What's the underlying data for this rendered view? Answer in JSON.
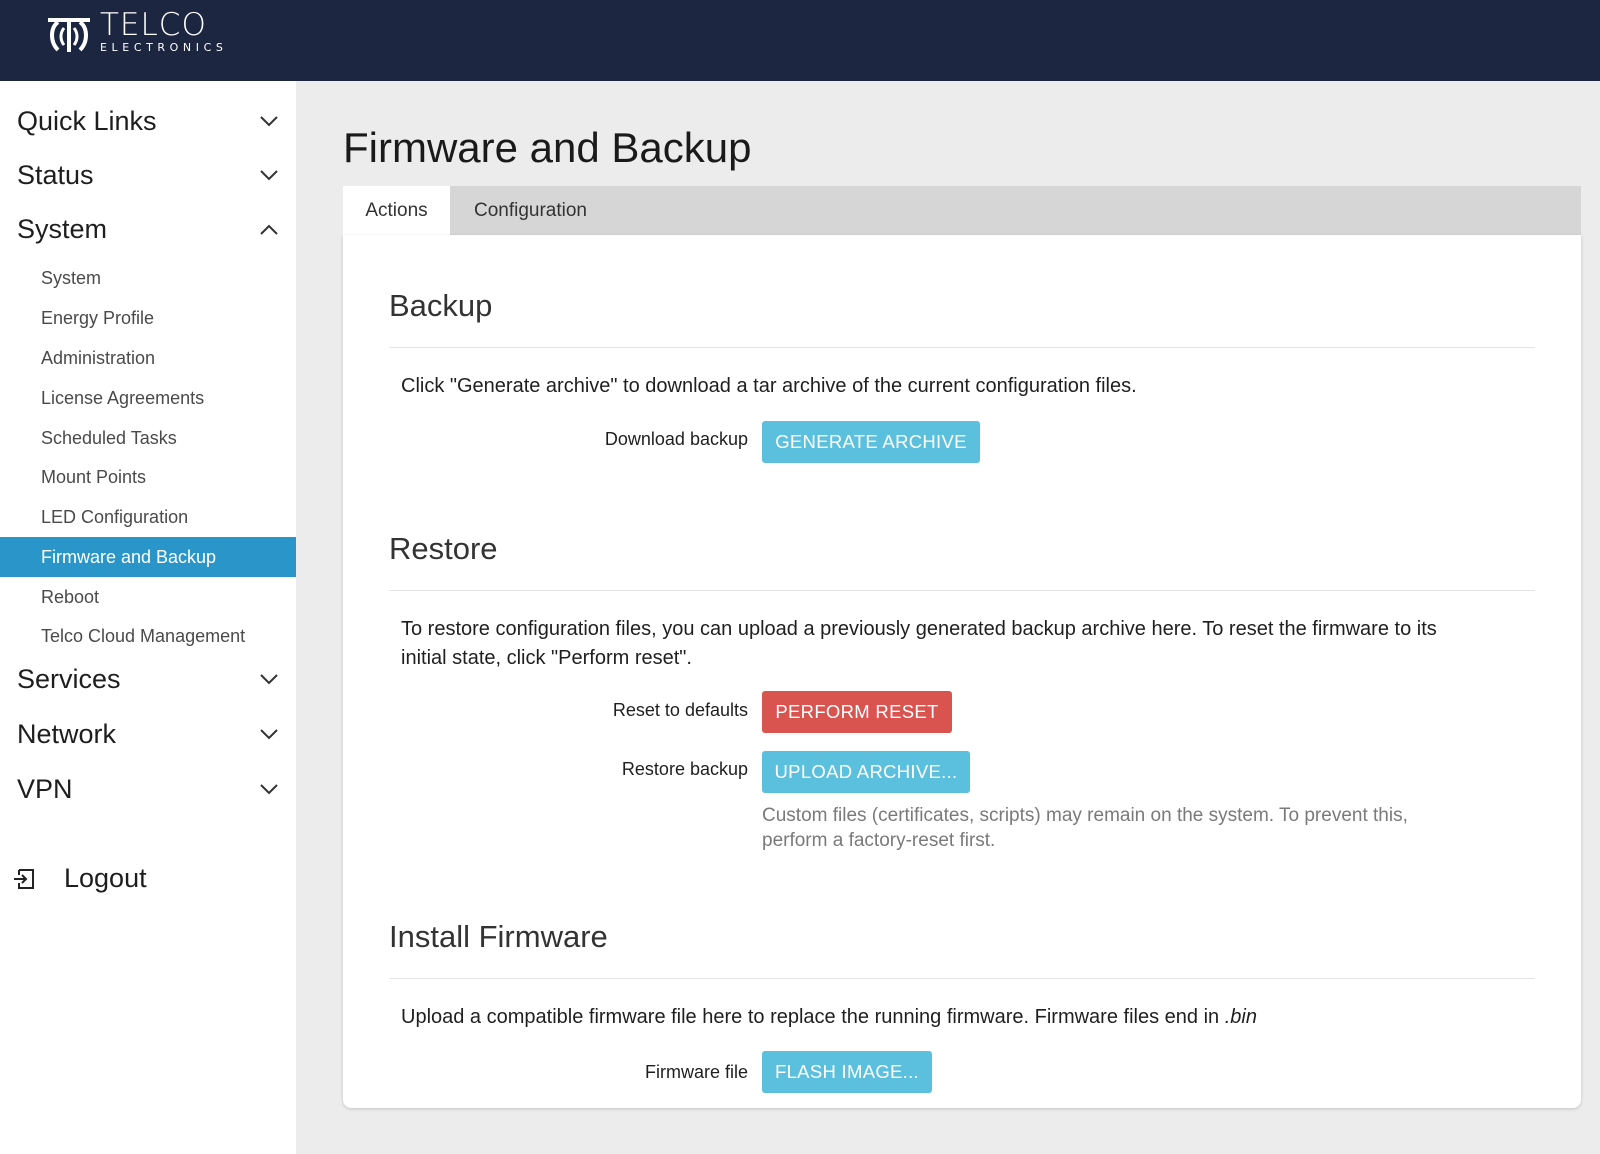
{
  "brand": {
    "name": "TELCO",
    "subtitle": "ELECTRONICS",
    "logo_icon": "telco-logo-mark",
    "header_bg": "#1c2640"
  },
  "sidebar": {
    "groups": [
      {
        "label": "Quick Links",
        "icon": "chevron-down-icon"
      },
      {
        "label": "Status",
        "icon": "chevron-down-icon"
      },
      {
        "label": "System",
        "icon": "chevron-up-icon"
      },
      {
        "label": "Services",
        "icon": "chevron-down-icon"
      },
      {
        "label": "Network",
        "icon": "chevron-down-icon"
      },
      {
        "label": "VPN",
        "icon": "chevron-down-icon"
      }
    ],
    "system_items": [
      "System",
      "Energy Profile",
      "Administration",
      "License Agreements",
      "Scheduled Tasks",
      "Mount Points",
      "LED Configuration",
      "Firmware and Backup",
      "Reboot",
      "Telco Cloud Management"
    ],
    "active_item": "Firmware and Backup",
    "active_color": "#2a95c8",
    "logout_label": "Logout"
  },
  "page": {
    "title": "Firmware and Backup",
    "tabs": [
      {
        "label": "Actions",
        "active": true
      },
      {
        "label": "Configuration",
        "active": false
      }
    ]
  },
  "backup": {
    "title": "Backup",
    "description": "Click \"Generate archive\" to download a tar archive of the current configuration files.",
    "download_label": "Download backup",
    "generate_button": "GENERATE ARCHIVE"
  },
  "restore": {
    "title": "Restore",
    "description_line1": "To restore configuration files, you can upload a previously generated backup archive here. To reset the firmware to its",
    "description_line2": "initial state, click \"Perform reset\".",
    "reset_label": "Reset to defaults",
    "reset_button": "PERFORM RESET",
    "restore_label": "Restore backup",
    "upload_button": "UPLOAD ARCHIVE...",
    "hint_line1": "Custom files (certificates, scripts) may remain on the system. To prevent this,",
    "hint_line2": "perform a factory-reset first."
  },
  "firmware": {
    "title": "Install Firmware",
    "description": "Upload a compatible firmware file here to replace the running firmware. Firmware files end in",
    "extension": ".bin",
    "file_label": "Firmware file",
    "flash_button": "FLASH IMAGE..."
  },
  "colors": {
    "info_button": "#5bc0de",
    "danger_button": "#d9534f"
  }
}
